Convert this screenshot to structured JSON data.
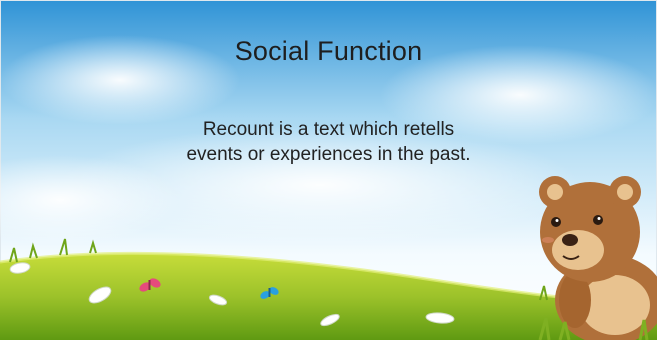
{
  "slide": {
    "title": "Social Function",
    "body_lines": [
      "Recount is a text which retells",
      "events or experiences in the past."
    ]
  },
  "colors": {
    "sky_top": "#2f93d6",
    "sky_mid": "#a9d8f2",
    "sky_bottom": "#f4fbff",
    "grass_light": "#c7dd3a",
    "grass_dark": "#5f9a12",
    "bear_fur": "#b0703a",
    "bear_light": "#e8c28f"
  },
  "decorations": {
    "character": "teddy-bear",
    "ground": "grass-hill",
    "flora": [
      "white-flower",
      "pink-butterfly",
      "blue-butterfly"
    ]
  }
}
